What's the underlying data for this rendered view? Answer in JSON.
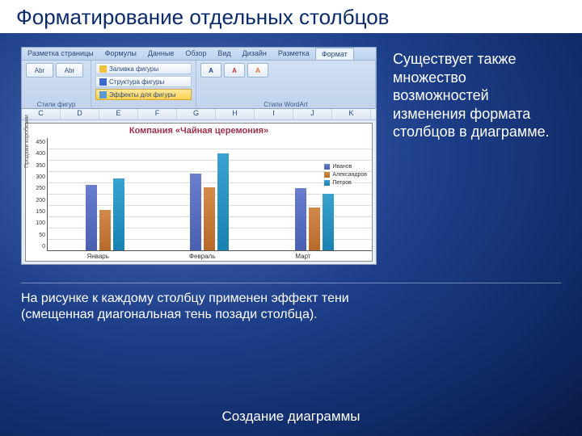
{
  "header_title": "Форматирование отдельных столбцов",
  "ribbon": {
    "tabs": [
      "Разметка страницы",
      "Формулы",
      "Данные",
      "Обзор",
      "Вид",
      "Дизайн",
      "Разметка",
      "Формат"
    ],
    "active_tab": "Формат",
    "insert_shapes": {
      "btn1": "Abr",
      "btn2": "Abr",
      "group_label": "Стили фигур"
    },
    "shape_styles": {
      "fill": "Заливка фигуры",
      "outline": "Структура фигуры",
      "effects": "Эффекты для фигуры"
    },
    "wordart_label": "Стили WordArt"
  },
  "columns": [
    "C",
    "D",
    "E",
    "F",
    "G",
    "H",
    "I",
    "J",
    "K"
  ],
  "chart": {
    "title": "Компания «Чайная церемония»",
    "ylabel": "Продажи коробками",
    "legend": [
      "Иванов",
      "Александров",
      "Петров"
    ]
  },
  "chart_data": {
    "type": "bar",
    "categories": [
      "Январь",
      "Февраль",
      "Март"
    ],
    "series": [
      {
        "name": "Иванов",
        "values": [
          290,
          340,
          275
        ]
      },
      {
        "name": "Александров",
        "values": [
          180,
          280,
          190
        ]
      },
      {
        "name": "Петров",
        "values": [
          320,
          430,
          250
        ]
      }
    ],
    "ylim": [
      0,
      450
    ],
    "ytick_step": 50,
    "yticks": [
      "450",
      "400",
      "350",
      "300",
      "250",
      "200",
      "150",
      "100",
      "50",
      "0"
    ]
  },
  "side_text": "Существует также множество возможностей изменения формата столбцов в диаграмме.",
  "caption_text": "На рисунке к каждому столбцу применен эффект тени (смещенная диагональная тень позади столбца).",
  "footer": "Создание диаграммы"
}
